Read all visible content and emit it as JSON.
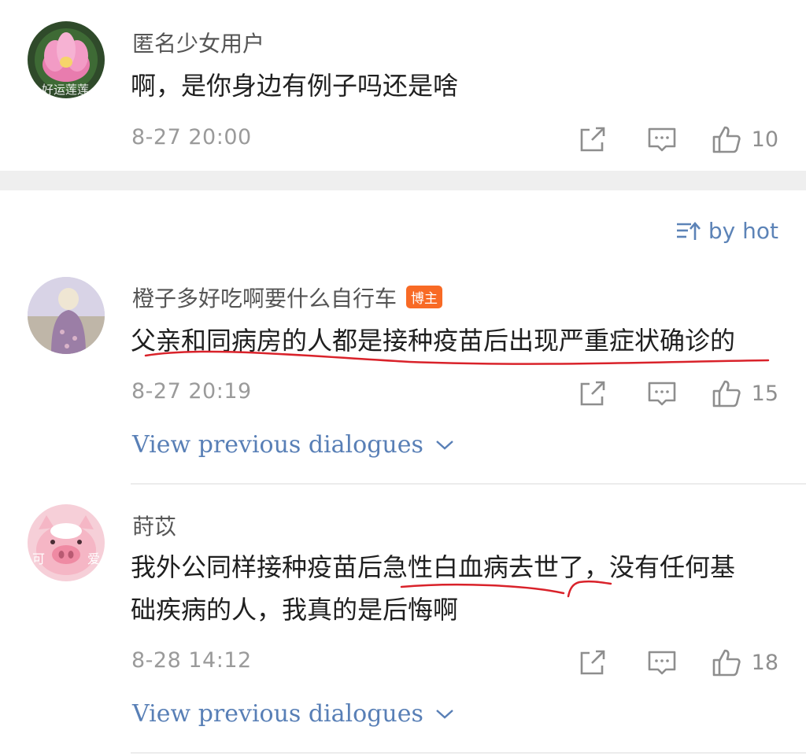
{
  "comments": [
    {
      "username": "匿名少女用户",
      "avatar_caption": "好运莲莲",
      "text": "啊，是你身边有例子吗还是啥",
      "time": "8-27 20:00",
      "likes": "10"
    },
    {
      "username": "橙子多好吃啊要什么自行车",
      "badge": "博主",
      "text": "父亲和同病房的人都是接种疫苗后出现严重症状确诊的",
      "time": "8-27 20:19",
      "likes": "15",
      "view_previous": "View previous dialogues"
    },
    {
      "username": "莳苡",
      "avatar_caption_left": "可",
      "avatar_caption_right": "爱",
      "text_line1": "我外公同样接种疫苗后急性白血病去世了，没有任何基",
      "text_line2": "础疾病的人，我真的是后悔啊",
      "time": "8-28 14:12",
      "likes": "18",
      "view_previous": "View previous dialogues"
    }
  ],
  "sort": {
    "label": "by hot"
  },
  "icons": {
    "share": "share-icon",
    "reply": "comment-icon",
    "like": "thumbs-up-icon",
    "sort": "sort-icon",
    "chevron": "chevron-down-icon"
  },
  "colors": {
    "link": "#587fb6",
    "badge": "#f86a25",
    "annotation": "#d9222a"
  }
}
